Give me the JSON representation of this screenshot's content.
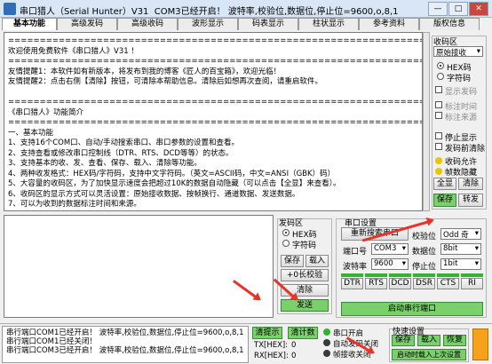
{
  "window": {
    "title": "串口猎人（Serial Hunter）V31",
    "status_text": "COM3已经开启！ 波特率,校验位,数据位,停止位=9600,o,8,1",
    "minimize": "—",
    "maximize": "□",
    "close": "✕"
  },
  "tabs": [
    "基本功能",
    "高级发码",
    "高级收码",
    "波形显示",
    "码表显示",
    "柱状显示",
    "参考资料",
    "版权信息"
  ],
  "receive_area": {
    "lines": [
      "==================================================================",
      "欢迎使用免费软件《串口猎人》V31 ！",
      "==================================================================",
      "友情提醒1：本软件如有新版本，将发布到我的博客《匠人的百宝箱》，欢迎光临！",
      "友情提醒2：点击右侧【清除】按钮，可清除本帮助信息。清除后如想再次查阅，请重启软件。",
      "",
      "==================================================================",
      "《串口猎人》功能简介",
      "==================================================================",
      "一、基本功能",
      "    1、支持16个COM口、自动/手动搜索串口、串口参数的设置和查看。",
      "    2、支持查看或修改串口控制线（DTR、RTS、DCD等等）的状态。",
      "    3、支持基本的收、发、查看、保存、载入、清除等功能。",
      "    4、两种收发格式：HEX码/字符码，支持中文字符码。（英文=ASCII码，中文=ANSI（GBK）码）",
      "    5、大容量的收码区，为了加快显示速度会把超过10K的数据自动隐藏（可以点击【全显】来查看）。",
      "    6、收码区的显示方式可以灵活设置：原始接收数据、按帧换行、通道数据、发送数据。",
      "    7、可以为收到的数据标注时间和来源。"
    ]
  },
  "recv_panel": {
    "title": "收码区",
    "mode": "原始接收",
    "hex": "HEX码",
    "char": "字符码",
    "show_send": "显示发码",
    "mark_time": "标注时间",
    "mark_source": "标注来源",
    "stop_display": "停止显示",
    "clear_after_send": "发码前清除",
    "collect_enable": "收码允许",
    "frame_hide": "帧数隐藏",
    "btn_fullshow": "全显",
    "btn_clear": "清除",
    "btn_save": "保存",
    "btn_dump": "转发"
  },
  "send_panel": {
    "title": "发码区",
    "hex": "HEX码",
    "char": "字符码",
    "btn_save": "保存",
    "btn_load": "载入",
    "btn_checksum": "+0长校验",
    "btn_clear": "清除",
    "btn_send": "发送"
  },
  "serial_settings": {
    "title": "串口设置",
    "btn_research": "重新搜索串口",
    "parity_label": "校验位",
    "parity_value": "Odd 奇",
    "port_label": "端口号",
    "port_value": "COM3",
    "databits_label": "数据位",
    "databits_value": "8bit",
    "baud_label": "波特率",
    "baud_value": "9600",
    "stopbits_label": "停止位",
    "stopbits_value": "1bit",
    "lines": [
      "DTR",
      "RTS",
      "DCD",
      "DSR",
      "CTS",
      "RI"
    ],
    "btn_open": "启动串行端口"
  },
  "status": {
    "lines": [
      "串行端口COM1已经开启！ 波特率,校验位,数据位,停止位=9600,o,8,1",
      "串行端口COM1已经关闭！",
      "串行端口COM3已经开启！ 波特率,校验位,数据位,停止位=9600,o,8,1"
    ],
    "btn_clear_tips": "清提示",
    "btn_clear_count": "清计数",
    "tx_label": "TX[HEX]:",
    "tx_value": "0",
    "rx_label": "RX[HEX]:",
    "rx_value": "0",
    "port_open": "串口开启",
    "auto_send_off": "自动发码关闭",
    "frame_recv_off": "帧接收关闭",
    "quick_settings": "快速设置",
    "btn_q_save": "保存",
    "btn_q_load": "载入",
    "btn_q_restore": "恢复",
    "btn_q_hint": "启动时载入上次设置"
  },
  "colors": {
    "green_button": "#7ad06a",
    "annotation_arrow": "#e8332a"
  }
}
